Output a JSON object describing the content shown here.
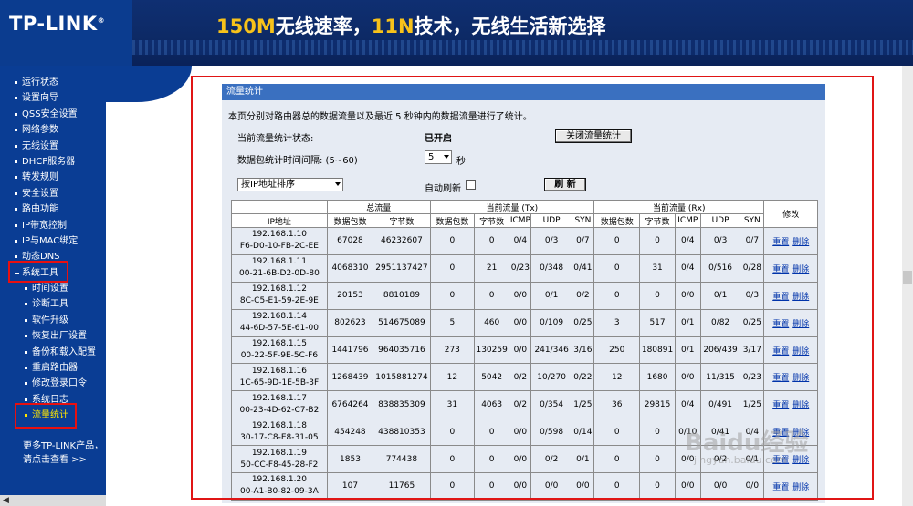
{
  "header": {
    "logo": "TP-LINK",
    "logo_mark": "®",
    "slogan_part1": "150M",
    "slogan_part2": "无线速率，",
    "slogan_part3": "11N",
    "slogan_part4": "技术，无线生活新选择"
  },
  "sidebar": {
    "items": [
      {
        "label": "运行状态"
      },
      {
        "label": "设置向导"
      },
      {
        "label": "QSS安全设置"
      },
      {
        "label": "网络参数"
      },
      {
        "label": "无线设置"
      },
      {
        "label": "DHCP服务器"
      },
      {
        "label": "转发规则"
      },
      {
        "label": "安全设置"
      },
      {
        "label": "路由功能"
      },
      {
        "label": "IP带宽控制"
      },
      {
        "label": "IP与MAC绑定"
      },
      {
        "label": "动态DNS"
      },
      {
        "label": "系统工具"
      },
      {
        "label": "时间设置"
      },
      {
        "label": "诊断工具"
      },
      {
        "label": "软件升级"
      },
      {
        "label": "恢复出厂设置"
      },
      {
        "label": "备份和载入配置"
      },
      {
        "label": "重启路由器"
      },
      {
        "label": "修改登录口令"
      },
      {
        "label": "系统日志"
      },
      {
        "label": "流量统计"
      }
    ],
    "more_line1": "更多TP-LINK产品，",
    "more_line2": "请点击查看 >>"
  },
  "panel": {
    "title": "流量统计",
    "description": "本页分别对路由器总的数据流量以及最近 5 秒钟内的数据流量进行了统计。",
    "status_label": "当前流量统计状态:",
    "status_value": "已开启",
    "toggle_button": "关闭流量统计",
    "interval_label": "数据包统计时间间隔: (5~60)",
    "interval_value": "5",
    "interval_unit": "秒",
    "sort_value": "按IP地址排序",
    "auto_refresh_label": "自动刷新",
    "refresh_button": "刷 新"
  },
  "table": {
    "group_headers": [
      "总流量",
      "当前流量 (Tx)",
      "当前流量 (Rx)",
      "修改"
    ],
    "columns": [
      "IP地址",
      "数据包数",
      "字节数",
      "数据包数",
      "字节数",
      "ICMP",
      "UDP",
      "SYN",
      "数据包数",
      "字节数",
      "ICMP",
      "UDP",
      "SYN"
    ],
    "reset_label": "重置",
    "delete_label": "删除",
    "rows": [
      {
        "ip": "192.168.1.10",
        "mac": "F6-D0-10-FB-2C-EE",
        "cells": [
          "67028",
          "46232607",
          "0",
          "0",
          "0/4",
          "0/3",
          "0/7",
          "0",
          "0",
          "0/4",
          "0/3",
          "0/7"
        ]
      },
      {
        "ip": "192.168.1.11",
        "mac": "00-21-6B-D2-0D-80",
        "cells": [
          "4068310",
          "2951137427",
          "0",
          "21",
          "0/23",
          "0/348",
          "0/41",
          "0",
          "31",
          "0/4",
          "0/516",
          "0/28"
        ]
      },
      {
        "ip": "192.168.1.12",
        "mac": "8C-C5-E1-59-2E-9E",
        "cells": [
          "20153",
          "8810189",
          "0",
          "0",
          "0/0",
          "0/1",
          "0/2",
          "0",
          "0",
          "0/0",
          "0/1",
          "0/3"
        ]
      },
      {
        "ip": "192.168.1.14",
        "mac": "44-6D-57-5E-61-00",
        "cells": [
          "802623",
          "514675089",
          "5",
          "460",
          "0/0",
          "0/109",
          "0/25",
          "3",
          "517",
          "0/1",
          "0/82",
          "0/25"
        ]
      },
      {
        "ip": "192.168.1.15",
        "mac": "00-22-5F-9E-5C-F6",
        "cells": [
          "1441796",
          "964035716",
          "273",
          "130259",
          "0/0",
          "241/346",
          "3/16",
          "250",
          "180891",
          "0/1",
          "206/439",
          "3/17"
        ]
      },
      {
        "ip": "192.168.1.16",
        "mac": "1C-65-9D-1E-5B-3F",
        "cells": [
          "1268439",
          "1015881274",
          "12",
          "5042",
          "0/2",
          "10/270",
          "0/22",
          "12",
          "1680",
          "0/0",
          "11/315",
          "0/23"
        ]
      },
      {
        "ip": "192.168.1.17",
        "mac": "00-23-4D-62-C7-B2",
        "cells": [
          "6764264",
          "838835309",
          "31",
          "4063",
          "0/2",
          "0/354",
          "1/25",
          "36",
          "29815",
          "0/4",
          "0/491",
          "1/25"
        ]
      },
      {
        "ip": "192.168.1.18",
        "mac": "30-17-C8-E8-31-05",
        "cells": [
          "454248",
          "438810353",
          "0",
          "0",
          "0/0",
          "0/598",
          "0/14",
          "0",
          "0",
          "0/10",
          "0/41",
          "0/4"
        ]
      },
      {
        "ip": "192.168.1.19",
        "mac": "50-CC-F8-45-28-F2",
        "cells": [
          "1853",
          "774438",
          "0",
          "0",
          "0/0",
          "0/2",
          "0/1",
          "0",
          "0",
          "0/0",
          "0/2",
          "0/1"
        ]
      },
      {
        "ip": "192.168.1.20",
        "mac": "00-A1-B0-82-09-3A",
        "cells": [
          "107",
          "11765",
          "0",
          "0",
          "0/0",
          "0/0",
          "0/0",
          "0",
          "0",
          "0/0",
          "0/0",
          "0/0"
        ]
      }
    ]
  },
  "watermark": {
    "main": "Baidu经验",
    "sub": "jingyan.baidu.com"
  },
  "colors": {
    "sidebar_bg": "#0a3d94",
    "title_bar": "#3a70c0",
    "panel_bg": "#e6ebf3",
    "highlight_red": "#e01515",
    "active_menu": "#ffe600"
  }
}
